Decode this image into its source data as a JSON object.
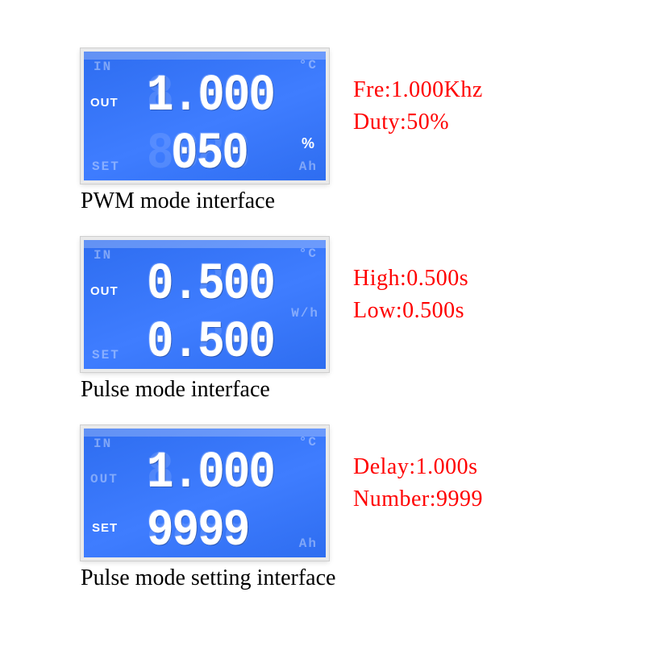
{
  "panels": [
    {
      "key": "pwm",
      "side_label_top": "OUT",
      "side_label_bottom": "",
      "ghost_top": "IN",
      "ghost_bottom": "SET",
      "ghost_right_top": "°C",
      "ghost_right_bottom": "Ah",
      "line1_digits": "1.000",
      "line2_digits": "050",
      "line2_unit": "%",
      "annotations": [
        "Fre:1.000Khz",
        "Duty:50%"
      ],
      "caption": "PWM mode interface"
    },
    {
      "key": "pulse",
      "side_label_top": "OUT",
      "side_label_bottom": "",
      "ghost_top": "IN",
      "ghost_bottom": "SET",
      "ghost_right_top": "°C",
      "ghost_right_bottom": "W/h",
      "line1_digits": "0.500",
      "line2_digits": "0.500",
      "line2_unit": "",
      "annotations": [
        "High:0.500s",
        "Low:0.500s"
      ],
      "caption": "Pulse mode interface"
    },
    {
      "key": "pulse_setting",
      "side_label_top": "",
      "side_label_bottom": "SET",
      "ghost_top": "IN",
      "ghost_bottom": "",
      "ghost_mid": "OUT",
      "ghost_right_top": "°C",
      "ghost_right_bottom": "Ah",
      "line1_digits": "1.000",
      "line2_digits": "9999",
      "line2_unit": "",
      "annotations": [
        "Delay:1.000s",
        "Number:9999"
      ],
      "caption": "Pulse mode setting interface"
    }
  ]
}
